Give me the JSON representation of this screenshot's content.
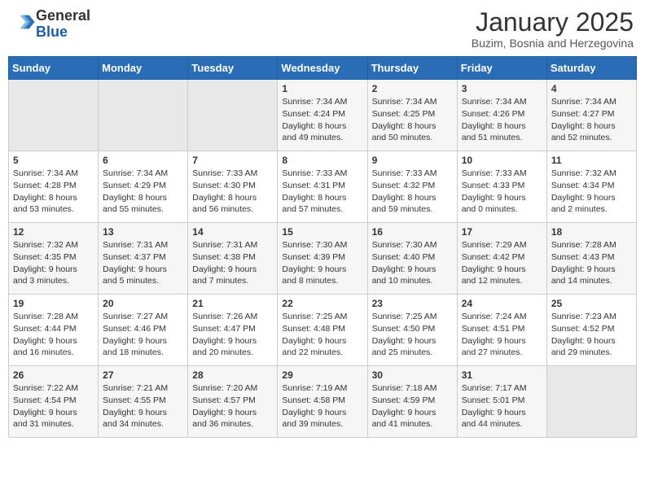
{
  "header": {
    "logo_general": "General",
    "logo_blue": "Blue",
    "month_title": "January 2025",
    "subtitle": "Buzim, Bosnia and Herzegovina"
  },
  "weekdays": [
    "Sunday",
    "Monday",
    "Tuesday",
    "Wednesday",
    "Thursday",
    "Friday",
    "Saturday"
  ],
  "weeks": [
    [
      {
        "day": "",
        "info": ""
      },
      {
        "day": "",
        "info": ""
      },
      {
        "day": "",
        "info": ""
      },
      {
        "day": "1",
        "info": "Sunrise: 7:34 AM\nSunset: 4:24 PM\nDaylight: 8 hours\nand 49 minutes."
      },
      {
        "day": "2",
        "info": "Sunrise: 7:34 AM\nSunset: 4:25 PM\nDaylight: 8 hours\nand 50 minutes."
      },
      {
        "day": "3",
        "info": "Sunrise: 7:34 AM\nSunset: 4:26 PM\nDaylight: 8 hours\nand 51 minutes."
      },
      {
        "day": "4",
        "info": "Sunrise: 7:34 AM\nSunset: 4:27 PM\nDaylight: 8 hours\nand 52 minutes."
      }
    ],
    [
      {
        "day": "5",
        "info": "Sunrise: 7:34 AM\nSunset: 4:28 PM\nDaylight: 8 hours\nand 53 minutes."
      },
      {
        "day": "6",
        "info": "Sunrise: 7:34 AM\nSunset: 4:29 PM\nDaylight: 8 hours\nand 55 minutes."
      },
      {
        "day": "7",
        "info": "Sunrise: 7:33 AM\nSunset: 4:30 PM\nDaylight: 8 hours\nand 56 minutes."
      },
      {
        "day": "8",
        "info": "Sunrise: 7:33 AM\nSunset: 4:31 PM\nDaylight: 8 hours\nand 57 minutes."
      },
      {
        "day": "9",
        "info": "Sunrise: 7:33 AM\nSunset: 4:32 PM\nDaylight: 8 hours\nand 59 minutes."
      },
      {
        "day": "10",
        "info": "Sunrise: 7:33 AM\nSunset: 4:33 PM\nDaylight: 9 hours\nand 0 minutes."
      },
      {
        "day": "11",
        "info": "Sunrise: 7:32 AM\nSunset: 4:34 PM\nDaylight: 9 hours\nand 2 minutes."
      }
    ],
    [
      {
        "day": "12",
        "info": "Sunrise: 7:32 AM\nSunset: 4:35 PM\nDaylight: 9 hours\nand 3 minutes."
      },
      {
        "day": "13",
        "info": "Sunrise: 7:31 AM\nSunset: 4:37 PM\nDaylight: 9 hours\nand 5 minutes."
      },
      {
        "day": "14",
        "info": "Sunrise: 7:31 AM\nSunset: 4:38 PM\nDaylight: 9 hours\nand 7 minutes."
      },
      {
        "day": "15",
        "info": "Sunrise: 7:30 AM\nSunset: 4:39 PM\nDaylight: 9 hours\nand 8 minutes."
      },
      {
        "day": "16",
        "info": "Sunrise: 7:30 AM\nSunset: 4:40 PM\nDaylight: 9 hours\nand 10 minutes."
      },
      {
        "day": "17",
        "info": "Sunrise: 7:29 AM\nSunset: 4:42 PM\nDaylight: 9 hours\nand 12 minutes."
      },
      {
        "day": "18",
        "info": "Sunrise: 7:28 AM\nSunset: 4:43 PM\nDaylight: 9 hours\nand 14 minutes."
      }
    ],
    [
      {
        "day": "19",
        "info": "Sunrise: 7:28 AM\nSunset: 4:44 PM\nDaylight: 9 hours\nand 16 minutes."
      },
      {
        "day": "20",
        "info": "Sunrise: 7:27 AM\nSunset: 4:46 PM\nDaylight: 9 hours\nand 18 minutes."
      },
      {
        "day": "21",
        "info": "Sunrise: 7:26 AM\nSunset: 4:47 PM\nDaylight: 9 hours\nand 20 minutes."
      },
      {
        "day": "22",
        "info": "Sunrise: 7:25 AM\nSunset: 4:48 PM\nDaylight: 9 hours\nand 22 minutes."
      },
      {
        "day": "23",
        "info": "Sunrise: 7:25 AM\nSunset: 4:50 PM\nDaylight: 9 hours\nand 25 minutes."
      },
      {
        "day": "24",
        "info": "Sunrise: 7:24 AM\nSunset: 4:51 PM\nDaylight: 9 hours\nand 27 minutes."
      },
      {
        "day": "25",
        "info": "Sunrise: 7:23 AM\nSunset: 4:52 PM\nDaylight: 9 hours\nand 29 minutes."
      }
    ],
    [
      {
        "day": "26",
        "info": "Sunrise: 7:22 AM\nSunset: 4:54 PM\nDaylight: 9 hours\nand 31 minutes."
      },
      {
        "day": "27",
        "info": "Sunrise: 7:21 AM\nSunset: 4:55 PM\nDaylight: 9 hours\nand 34 minutes."
      },
      {
        "day": "28",
        "info": "Sunrise: 7:20 AM\nSunset: 4:57 PM\nDaylight: 9 hours\nand 36 minutes."
      },
      {
        "day": "29",
        "info": "Sunrise: 7:19 AM\nSunset: 4:58 PM\nDaylight: 9 hours\nand 39 minutes."
      },
      {
        "day": "30",
        "info": "Sunrise: 7:18 AM\nSunset: 4:59 PM\nDaylight: 9 hours\nand 41 minutes."
      },
      {
        "day": "31",
        "info": "Sunrise: 7:17 AM\nSunset: 5:01 PM\nDaylight: 9 hours\nand 44 minutes."
      },
      {
        "day": "",
        "info": ""
      }
    ]
  ]
}
